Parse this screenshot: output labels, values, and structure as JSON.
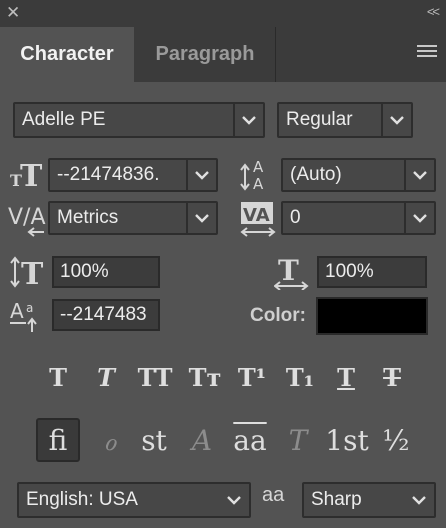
{
  "header": {
    "close_icon": "close-icon",
    "collapse_label": "<<"
  },
  "tabs": [
    {
      "label": "Character",
      "active": true
    },
    {
      "label": "Paragraph",
      "active": false
    }
  ],
  "font": {
    "family": "Adelle PE",
    "style": "Regular"
  },
  "metrics": {
    "size": "--21474836.",
    "leading": "(Auto)",
    "kerning": "Metrics",
    "tracking": "0",
    "vertical_scale": "100%",
    "horizontal_scale": "100%",
    "baseline_shift": "--2147483",
    "color_label": "Color:",
    "color_value": "#000000"
  },
  "type_styles": [
    "T",
    "T",
    "TT",
    "Tт",
    "T¹",
    "T₁",
    "T",
    "T"
  ],
  "opentype": [
    "ﬁ",
    "ℴ",
    "st",
    "A",
    "aa",
    "T",
    "1st",
    "½"
  ],
  "bottom": {
    "language": "English: USA",
    "aa_label": "aa",
    "antialias": "Sharp"
  }
}
